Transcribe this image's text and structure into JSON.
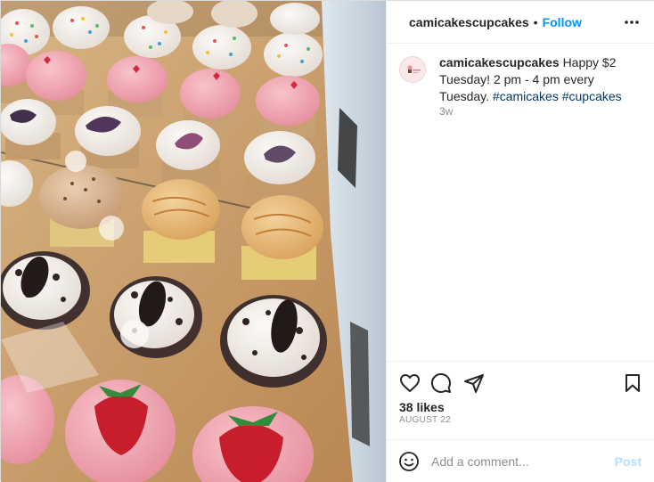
{
  "post": {
    "username": "camicakescupcakes",
    "separator": "•",
    "follow_label": "Follow",
    "more_icon": "more-options-icon"
  },
  "caption": {
    "username": "camicakescupcakes",
    "body": "Happy $2 Tuesday! 2 pm - 4 pm every Tuesday.",
    "hashtags": [
      "#camicakes",
      "#cupcakes"
    ],
    "time": "3w",
    "avatar_icon": "profile-avatar"
  },
  "actions": {
    "like_icon": "heart-icon",
    "comment_icon": "comment-icon",
    "share_icon": "share-icon",
    "save_icon": "bookmark-icon",
    "likes": "38 likes",
    "date": "AUGUST 22"
  },
  "comment_box": {
    "placeholder": "Add a comment...",
    "post_label": "Post",
    "emoji_icon": "emoji-icon"
  },
  "colors": {
    "follow": "#0095f6",
    "hashtag": "#00376b",
    "post_disabled": "#b2dffc",
    "muted": "#8e8e8e"
  }
}
